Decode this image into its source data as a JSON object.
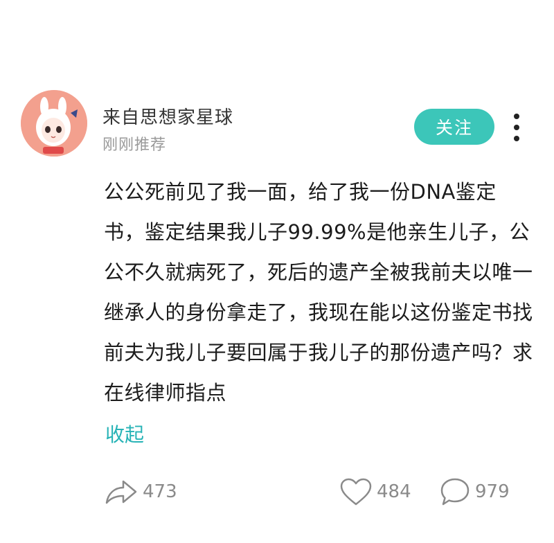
{
  "post": {
    "author_name": "来自思想家星球",
    "subtitle": "刚刚推荐",
    "follow_label": "关注",
    "content": "公公死前见了我一面，给了我一份DNA鉴定书，鉴定结果我儿子99.99%是他亲生儿子，公公不久就病死了，死后的遗产全被我前夫以唯一继承人的身份拿走了，我现在能以这份鉴定书找前夫为我儿子要回属于我儿子的那份遗产吗？求在线律师指点",
    "collapse_label": "收起"
  },
  "actions": {
    "share_icon": "share-arrow-icon",
    "share_count": "473",
    "like_icon": "heart-icon",
    "like_count": "484",
    "comment_icon": "speech-bubble-icon",
    "comment_count": "979"
  },
  "colors": {
    "accent": "#3cc6b9",
    "link": "#27b3b6",
    "avatar_bg": "#f3a08e",
    "muted": "#999999"
  }
}
